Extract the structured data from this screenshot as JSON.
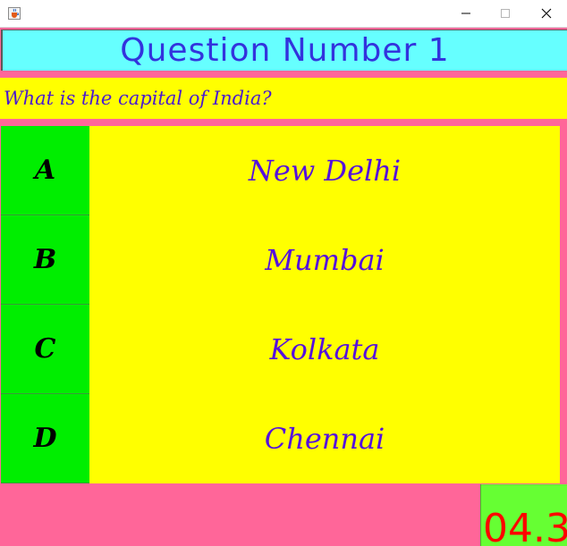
{
  "window": {
    "title": "",
    "controls": [
      "minimize",
      "maximize",
      "close"
    ]
  },
  "quiz": {
    "question_number_label": "Question Number 1",
    "question_text": "What is the capital of India?",
    "options": [
      {
        "letter": "A",
        "text": "New Delhi"
      },
      {
        "letter": "B",
        "text": "Mumbai"
      },
      {
        "letter": "C",
        "text": "Kolkata"
      },
      {
        "letter": "D",
        "text": "Chennai"
      }
    ],
    "timer": "04.3"
  },
  "colors": {
    "background": "#ff6699",
    "header": "#66ffff",
    "question_bg": "#ffff00",
    "option_letter_bg": "#00ee00",
    "option_text_color": "#5511dd",
    "timer_bg": "#66ff33",
    "timer_text": "#ff0000"
  },
  "icons": {
    "app": "java-cup-icon",
    "minimize": "minimize-icon",
    "maximize": "maximize-icon",
    "close": "close-icon"
  }
}
